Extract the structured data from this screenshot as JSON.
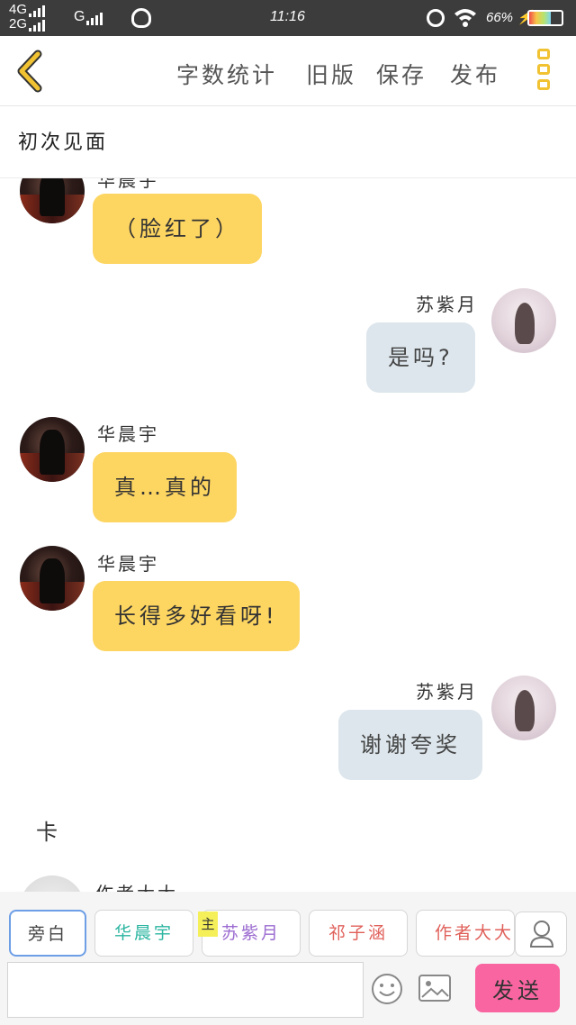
{
  "status_bar": {
    "network_top": "4G",
    "network_bottom": "2G",
    "network_g": "G",
    "time": "11:16",
    "battery_percent": "66%",
    "battery_level": 0.66
  },
  "toolbar": {
    "word_count": "字数统计",
    "old_version": "旧版",
    "save": "保存",
    "publish": "发布"
  },
  "title": "初次见面",
  "chat": {
    "messages": [
      {
        "side": "left",
        "name": "华晨宇",
        "text": "（脸红了）"
      },
      {
        "side": "right",
        "name": "苏紫月",
        "text": "是吗?"
      },
      {
        "side": "left",
        "name": "华晨宇",
        "text": "真…真的"
      },
      {
        "side": "left",
        "name": "华晨宇",
        "text": "长得多好看呀!"
      },
      {
        "side": "right",
        "name": "苏紫月",
        "text": "谢谢夸奖"
      }
    ],
    "narration": "卡",
    "next_name": "作者大大"
  },
  "roles": {
    "items": [
      "旁白",
      "华晨宇",
      "苏紫月",
      "祁子涵",
      "作者大大"
    ],
    "main_badge": "主",
    "colors": [
      "#444444",
      "#2bb5a0",
      "#9b6bd0",
      "#e0605a",
      "#e0605a"
    ]
  },
  "input": {
    "placeholder": "",
    "send_label": "发送"
  },
  "colors": {
    "accent_yellow": "#fdd561",
    "bubble_blue": "#dde6ec",
    "send_pink": "#f865a0"
  }
}
